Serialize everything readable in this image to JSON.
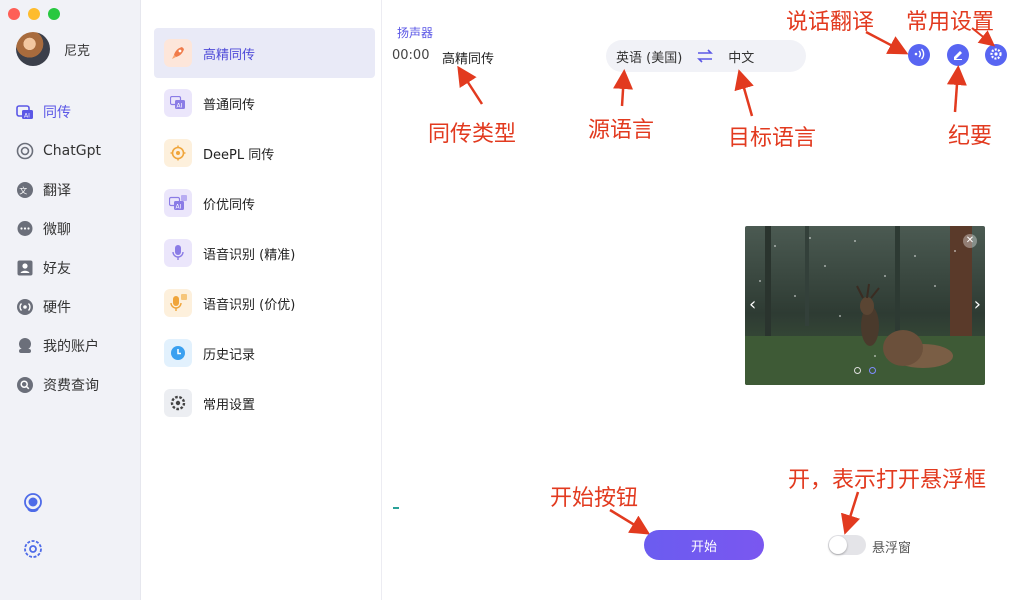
{
  "sidebar": {
    "user_name": "尼克",
    "items": [
      {
        "label": "同传",
        "icon": "ai-translate-icon"
      },
      {
        "label": "ChatGpt",
        "icon": "chatgpt-icon"
      },
      {
        "label": "翻译",
        "icon": "translate-icon"
      },
      {
        "label": "微聊",
        "icon": "chat-bubble-icon"
      },
      {
        "label": "好友",
        "icon": "contact-icon"
      },
      {
        "label": "硬件",
        "icon": "broadcast-icon"
      },
      {
        "label": "我的账户",
        "icon": "account-icon"
      },
      {
        "label": "资费查询",
        "icon": "search-icon"
      }
    ],
    "bottom": [
      "headset-support-icon",
      "gear-icon"
    ]
  },
  "menu": {
    "items": [
      {
        "label": "高精同传",
        "icon": "rocket-icon"
      },
      {
        "label": "普通同传",
        "icon": "ai-icon"
      },
      {
        "label": "DeePL 同传",
        "icon": "target-icon"
      },
      {
        "label": "价优同传",
        "icon": "ai-discount-icon"
      },
      {
        "label": "语音识别 (精准)",
        "icon": "microphone-icon"
      },
      {
        "label": "语音识别 (价优)",
        "icon": "microphone-discount-icon"
      },
      {
        "label": "历史记录",
        "icon": "clock-icon"
      },
      {
        "label": "常用设置",
        "icon": "settings-icon"
      }
    ]
  },
  "main": {
    "speaker": "扬声器",
    "time": "00:00",
    "type": "高精同传",
    "source_lang": "英语 (美国)",
    "target_lang": "中文",
    "start_label": "开始",
    "float_label": "悬浮窗",
    "float_on": false
  },
  "annotations": {
    "speak_translate": "说话翻译",
    "settings": "常用设置",
    "sync_type": "同传类型",
    "source_lang": "源语言",
    "target_lang": "目标语言",
    "summary": "纪要",
    "start_button": "开始按钮",
    "float_on": "开，表示打开悬浮框"
  },
  "colors": {
    "accent": "#5b57e6",
    "annotation": "#e23a1f",
    "button_blue": "#5865f2"
  }
}
